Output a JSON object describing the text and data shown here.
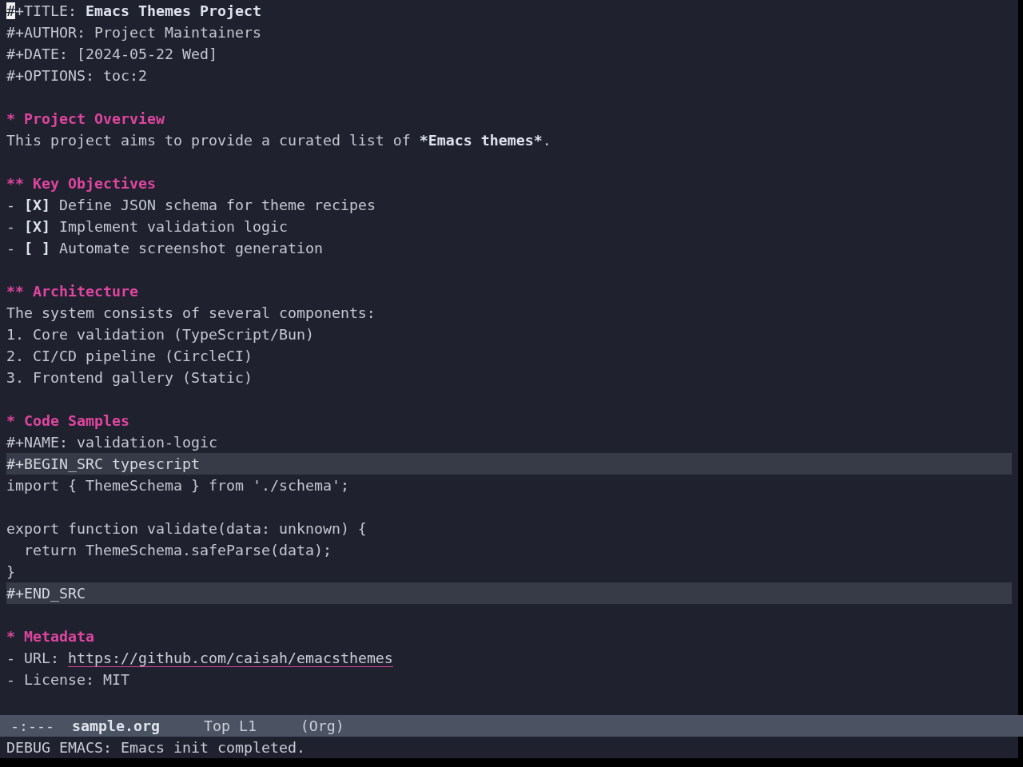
{
  "buffer": {
    "lines": [
      {
        "kind": "keyword",
        "key": "#+TITLE:",
        "value": "Emacs Themes Project",
        "bold": true,
        "cursor": true
      },
      {
        "kind": "keyword",
        "key": "#+AUTHOR:",
        "value": "Project Maintainers",
        "bold": false,
        "cursor": false
      },
      {
        "kind": "keyword",
        "key": "#+DATE:",
        "value": "[2024-05-22 Wed]",
        "bold": false,
        "cursor": false
      },
      {
        "kind": "keyword",
        "key": "#+OPTIONS:",
        "value": "toc:2",
        "bold": false,
        "cursor": false
      },
      {
        "kind": "blank",
        "cursor": false
      },
      {
        "kind": "heading",
        "stars": "*",
        "text": "Project Overview",
        "cursor": false
      },
      {
        "kind": "paragraph",
        "segments": [
          {
            "text": "This project aims to provide a curated list of ",
            "bold": false
          },
          {
            "text": "*Emacs themes*",
            "bold": true
          },
          {
            "text": ".",
            "bold": false
          }
        ],
        "cursor": false
      },
      {
        "kind": "blank",
        "cursor": false
      },
      {
        "kind": "heading",
        "stars": "**",
        "text": "Key Objectives",
        "cursor": false
      },
      {
        "kind": "checkbox",
        "bullet": "-",
        "box": "[X]",
        "text": "Define JSON schema for theme recipes",
        "cursor": false
      },
      {
        "kind": "checkbox",
        "bullet": "-",
        "box": "[X]",
        "text": "Implement validation logic",
        "cursor": false
      },
      {
        "kind": "checkbox",
        "bullet": "-",
        "box": "[ ]",
        "text": "Automate screenshot generation",
        "cursor": false
      },
      {
        "kind": "blank",
        "cursor": false
      },
      {
        "kind": "heading",
        "stars": "**",
        "text": "Architecture",
        "cursor": false
      },
      {
        "kind": "text",
        "text": "The system consists of several components:",
        "cursor": false
      },
      {
        "kind": "text",
        "text": "1. Core validation (TypeScript/Bun)",
        "cursor": false
      },
      {
        "kind": "text",
        "text": "2. CI/CD pipeline (CircleCI)",
        "cursor": false
      },
      {
        "kind": "text",
        "text": "3. Frontend gallery (Static)",
        "cursor": false
      },
      {
        "kind": "blank",
        "cursor": false
      },
      {
        "kind": "heading",
        "stars": "*",
        "text": "Code Samples",
        "cursor": false
      },
      {
        "kind": "text",
        "text": "#+NAME: validation-logic",
        "cursor": false
      },
      {
        "kind": "src_delimiter",
        "text": "#+BEGIN_SRC typescript",
        "cursor": false
      },
      {
        "kind": "code",
        "text": "import { ThemeSchema } from './schema';",
        "cursor": false
      },
      {
        "kind": "blank",
        "cursor": false
      },
      {
        "kind": "code",
        "text": "export function validate(data: unknown) {",
        "cursor": false
      },
      {
        "kind": "code",
        "text": "  return ThemeSchema.safeParse(data);",
        "cursor": false
      },
      {
        "kind": "code",
        "text": "}",
        "cursor": false
      },
      {
        "kind": "src_delimiter",
        "text": "#+END_SRC",
        "cursor": false
      },
      {
        "kind": "blank",
        "cursor": false
      },
      {
        "kind": "heading",
        "stars": "*",
        "text": "Metadata",
        "cursor": false
      },
      {
        "kind": "link_item",
        "label": "- URL:",
        "url": "https://github.com/caisah/emacsthemes",
        "cursor": false
      },
      {
        "kind": "text",
        "text": "- License: MIT",
        "cursor": false
      }
    ]
  },
  "mode_line": {
    "status": "-:---",
    "buffer_name": "sample.org",
    "position": "Top L1",
    "mode": "(Org)"
  },
  "echo_area": {
    "message": "DEBUG EMACS: Emacs init completed."
  }
}
